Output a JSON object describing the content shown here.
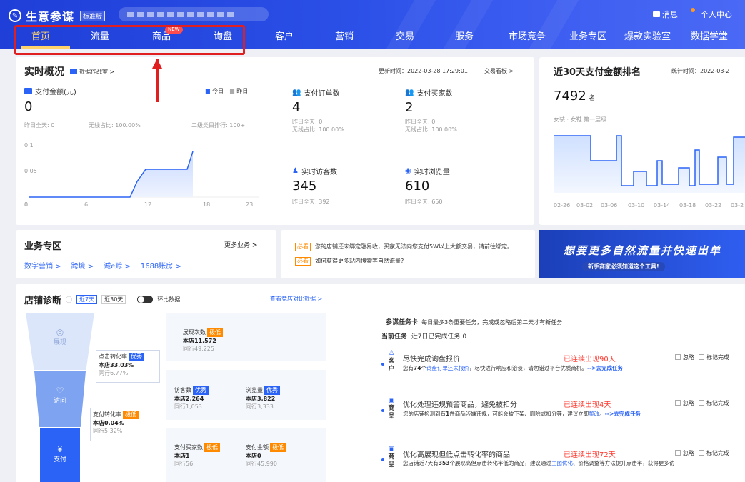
{
  "header": {
    "app_title": "生意参谋",
    "edition": "标准版",
    "messages": "消息",
    "user_center": "个人中心",
    "nav": [
      "首页",
      "流量",
      "商品",
      "询盘",
      "客户",
      "营销",
      "交易",
      "服务",
      "市场竞争",
      "业务专区",
      "爆款实验室",
      "数据学堂"
    ],
    "new_badge": "NEW"
  },
  "realtime": {
    "title": "实时概况",
    "war_room": "数据作战室 >",
    "update_time": "更新时间：2022-03-28 17:29:01",
    "trade_board": "交易看板 >",
    "pay_amount": {
      "label": "支付金额(元)",
      "value": "0",
      "yesterday": "昨日全天: 0",
      "wireless": "无线占比: 100.00%",
      "rank": "二级类目排行: 100+"
    },
    "legend_today": "今日",
    "legend_yesterday": "昨日",
    "pay_orders": {
      "label": "支付订单数",
      "value": "4",
      "yesterday": "昨日全天: 0",
      "wireless": "无线占比: 100.00%"
    },
    "pay_buyers": {
      "label": "支付买家数",
      "value": "2",
      "yesterday": "昨日全天: 0",
      "wireless": "无线占比: 100.00%"
    },
    "visitors": {
      "label": "实时访客数",
      "value": "345",
      "yesterday": "昨日全天: 392"
    },
    "pageviews": {
      "label": "实时浏览量",
      "value": "610",
      "yesterday": "昨日全天: 650"
    },
    "chart_y": [
      "0.1",
      "0.05",
      "0"
    ],
    "chart_x": [
      "0",
      "6",
      "12",
      "18",
      "23"
    ]
  },
  "ranking": {
    "title": "近30天支付金额排名",
    "stat_time": "统计时间：2022-03-2",
    "rank": "7492",
    "rank_unit": "名",
    "category": "女装 · 女鞋  第一层级",
    "x_labels": [
      "02-26",
      "03-02",
      "03-06",
      "03-10",
      "03-14",
      "03-18",
      "03-22",
      "03-2"
    ]
  },
  "business": {
    "title": "业务专区",
    "more": "更多业务",
    "links": [
      "数字营销 >",
      "跨境 >",
      "诚e赊 >",
      "1688账房 >"
    ]
  },
  "notices": {
    "tag": "必看",
    "items": [
      "您的店铺还未绑定融易收，买家无法向您支付5W以上大额交易，请前往绑定。",
      "如何获得更多站内搜索等自然流量?"
    ]
  },
  "banner": {
    "main": "想要更多自然流量并快速出单",
    "sub": "新手商家必须知道这个工具!"
  },
  "diagnosis": {
    "title": "店铺诊断",
    "range_7": "近7天",
    "range_30": "近30天",
    "compare": "环比数据",
    "compare_link": "查看竞店对比数据 >",
    "funnel": [
      "展现",
      "访问",
      "支付"
    ],
    "impressions": {
      "label": "展现次数",
      "tag": "极低",
      "store": "本店11,572",
      "peer": "同行49,225"
    },
    "click_rate": {
      "label": "点击转化率",
      "tag": "优秀",
      "store": "本店33.03%",
      "peer": "同行6.77%"
    },
    "visitor_count": {
      "label": "访客数",
      "tag": "优秀",
      "store": "本店2,264",
      "peer": "同行1,053"
    },
    "view_count": {
      "label": "浏览量",
      "tag": "优秀",
      "store": "本店3,822",
      "peer": "同行3,333"
    },
    "pay_rate": {
      "label": "支付转化率",
      "tag": "极低",
      "store": "本店0.04%",
      "peer": "同行5.32%"
    },
    "pay_buyers": {
      "label": "支付买家数",
      "tag": "极低",
      "store": "本店1",
      "peer": "同行56"
    },
    "pay_amount": {
      "label": "支付金额",
      "tag": "极低",
      "store": "本店0",
      "peer": "同行45,990"
    }
  },
  "tasks": {
    "card_title": "参谋任务卡",
    "card_desc": "每日最多3条重要任务，完成或忽略后第二天才有新任务",
    "current": "当前任务",
    "done": "近7日已完成任务 0",
    "ignore": "忽略",
    "mark": "标记完成",
    "items": [
      {
        "cat": "客户",
        "title": "尽快完成询盘报价",
        "status": "已连续出现90天",
        "pre": "您有",
        "num": "74",
        "mid": "个",
        "link": "询盘订单还未报价",
        "desc": "，尽快进行响应和洽谈，请勿错过平台优质商机。",
        "action": "-->去完成任务"
      },
      {
        "cat": "商品",
        "title": "优化处理违规预警商品，避免被扣分",
        "status": "已连续出现4天",
        "pre": "您的店铺检测到有",
        "num": "1",
        "mid": "件商品涉嫌违规，可能会被下架、删除或扣分等，建议立即",
        "link": "整改",
        "desc": "。",
        "action": "-->去完成任务"
      },
      {
        "cat": "商品",
        "title": "优化高展现但低点击转化率的商品",
        "status": "已连续出现72天",
        "pre": "您店铺近7天有",
        "num": "353",
        "mid": "个展现高但点击转化率低的商品，建议通过",
        "link": "主图优化",
        "desc": "、价格调整等方法提升点击率，获得更多访",
        "action": ""
      }
    ]
  }
}
